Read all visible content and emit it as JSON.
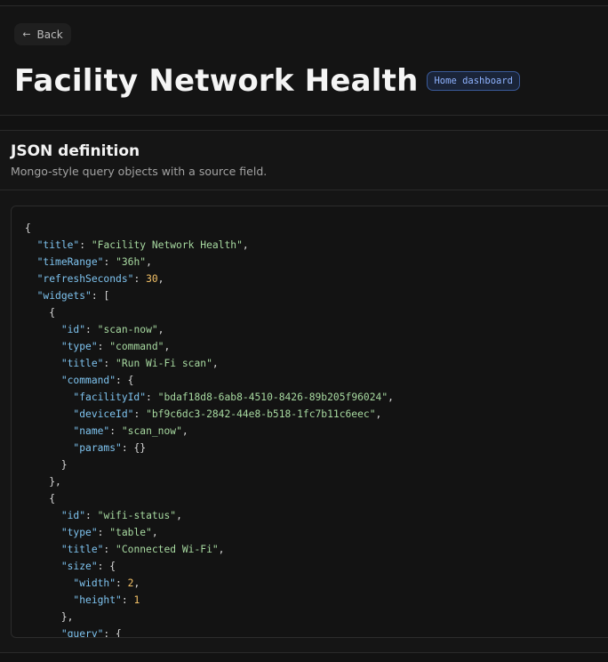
{
  "header": {
    "back_label": "Back",
    "title": "Facility Network Health",
    "badge": "Home dashboard"
  },
  "section": {
    "title": "JSON definition",
    "subtitle": "Mongo-style query objects with a source field."
  },
  "code_lines": [
    "{",
    "  \"title\": \"Facility Network Health\",",
    "  \"timeRange\": \"36h\",",
    "  \"refreshSeconds\": 30,",
    "  \"widgets\": [",
    "    {",
    "      \"id\": \"scan-now\",",
    "      \"type\": \"command\",",
    "      \"title\": \"Run Wi-Fi scan\",",
    "      \"command\": {",
    "        \"facilityId\": \"bdaf18d8-6ab8-4510-8426-89b205f96024\",",
    "        \"deviceId\": \"bf9c6dc3-2842-44e8-b518-1fc7b11c6eec\",",
    "        \"name\": \"scan_now\",",
    "        \"params\": {}",
    "      }",
    "    },",
    "    {",
    "      \"id\": \"wifi-status\",",
    "      \"type\": \"table\",",
    "      \"title\": \"Connected Wi-Fi\",",
    "      \"size\": {",
    "        \"width\": 2,",
    "        \"height\": 1",
    "      },",
    "      \"query\": {"
  ],
  "colors": {
    "key": "#7ec3ef",
    "string": "#a7d9a0",
    "number": "#f2c066",
    "badge": "#8fb3ff"
  }
}
